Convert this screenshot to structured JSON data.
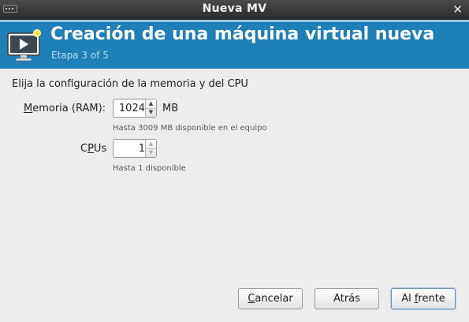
{
  "window": {
    "title": "Nueva MV",
    "close_glyph": "✕"
  },
  "banner": {
    "heading": "Creación de una máquina virtual nueva",
    "step": "Etapa 3 of 5",
    "icon": "monitor-play-icon",
    "color": "#1f7fb8"
  },
  "form": {
    "section_label": "Elija la configuración de la memoria y del CPU",
    "memory": {
      "label_mnemonic": "M",
      "label_rest": "emoria (RAM):",
      "value": "1024",
      "unit": "MB",
      "hint": "Hasta 3009 MB disponible en el equipo"
    },
    "cpus": {
      "label_pre": "C",
      "label_mnemonic": "P",
      "label_post": "Us",
      "value": "1",
      "hint": "Hasta 1 disponible"
    }
  },
  "buttons": {
    "cancel": {
      "mnemonic": "C",
      "rest": "ancelar"
    },
    "back": {
      "label": "Atrás"
    },
    "forward": {
      "pre": "Al ",
      "mnemonic": "f",
      "rest": "rente"
    }
  }
}
